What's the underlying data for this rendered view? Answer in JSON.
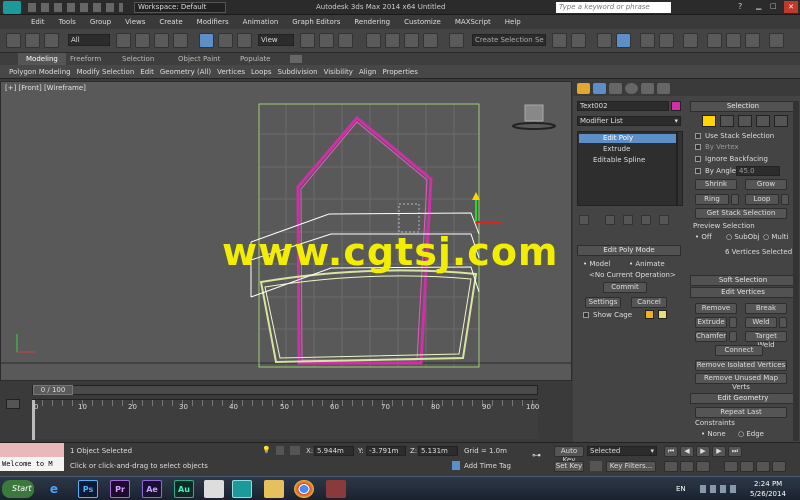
{
  "titlebar": {
    "workspace": "Workspace: Default",
    "title": "Autodesk 3ds Max  2014 x64     Untitled",
    "search_placeholder": "Type a keyword or phrase"
  },
  "menus": [
    "Edit",
    "Tools",
    "Group",
    "Views",
    "Create",
    "Modifiers",
    "Animation",
    "Graph Editors",
    "Rendering",
    "Customize",
    "MAXScript",
    "Help"
  ],
  "toolbar": {
    "filter": "All",
    "view": "View",
    "selection_set": "Create Selection Se"
  },
  "ribbon": {
    "tabs": [
      "Modeling",
      "Freeform",
      "Selection",
      "Object Paint",
      "Populate"
    ],
    "row": [
      "Polygon Modeling",
      "Modify Selection",
      "Edit",
      "Geometry (All)",
      "Vertices",
      "Loops",
      "Subdivision",
      "Visibility",
      "Align",
      "Properties"
    ]
  },
  "viewport": {
    "label": "[+] [Front] [Wireframe]",
    "watermark": "www.cgtsj.com"
  },
  "panel": {
    "object_name": "Text002",
    "modifier_list": "Modifier List",
    "stack": [
      "Edit Poly",
      "Extrude",
      "Editable Spline"
    ],
    "selection": {
      "title": "Selection",
      "use_stack": "Use Stack Selection",
      "by_vertex": "By Vertex",
      "ignore_backfacing": "Ignore Backfacing",
      "by_angle": "By Angle:",
      "angle_value": "45.0",
      "shrink": "Shrink",
      "grow": "Grow",
      "ring": "Ring",
      "loop": "Loop",
      "get_stack": "Get Stack Selection",
      "preview_title": "Preview Selection",
      "off": "Off",
      "subobj": "SubObj",
      "multi": "Multi",
      "status": "6 Vertices Selected"
    },
    "edit_poly_mode": {
      "title": "Edit Poly Mode",
      "model": "Model",
      "animate": "Animate",
      "operation": "<No Current Operation>",
      "commit": "Commit",
      "settings": "Settings",
      "cancel": "Cancel",
      "show_cage": "Show Cage"
    },
    "soft_selection": "Soft Selection",
    "edit_vertices": {
      "title": "Edit Vertices",
      "remove": "Remove",
      "break": "Break",
      "extrude": "Extrude",
      "weld": "Weld",
      "chamfer": "Chamfer",
      "target_weld": "Target Weld",
      "connect": "Connect",
      "remove_isolated": "Remove Isolated Vertices",
      "remove_unused": "Remove Unused Map Verts"
    },
    "edit_geometry": {
      "title": "Edit Geometry",
      "repeat_last": "Repeat Last",
      "constraints": "Constraints",
      "none": "None",
      "edge": "Edge"
    }
  },
  "timeline": {
    "frame": "0 / 100",
    "ticks": [
      "0",
      "10",
      "20",
      "30",
      "40",
      "50",
      "60",
      "70",
      "80",
      "90",
      "100"
    ]
  },
  "status": {
    "welcome": "Welcome to M",
    "objects": "1 Object Selected",
    "prompt": "Click or click-and-drag to select objects",
    "x_label": "X:",
    "x": "5.944m",
    "y_label": "Y:",
    "y": "-3.791m",
    "z_label": "Z:",
    "z": "5.131m",
    "grid": "Grid = 1.0m",
    "add_time_tag": "Add Time Tag",
    "auto_key": "Auto Key",
    "set_key": "Set Key",
    "selected": "Selected",
    "key_filters": "Key Filters..."
  },
  "taskbar": {
    "start": "Start",
    "lang": "EN",
    "time": "2:24 PM",
    "date": "5/26/2014",
    "apps": [
      "Ps",
      "Pr",
      "Ae",
      "Au"
    ]
  }
}
